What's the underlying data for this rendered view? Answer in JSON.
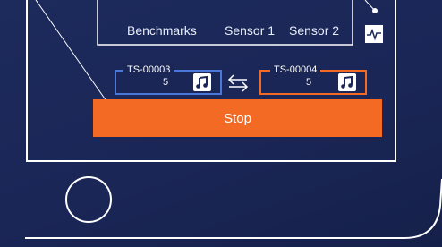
{
  "tabs": [
    "Benchmarks",
    "Sensor 1",
    "Sensor 2"
  ],
  "sources": [
    {
      "id": "TS-00003",
      "count": "5",
      "color": "#4a78d8"
    },
    {
      "id": "TS-00004",
      "count": "5",
      "color": "#f26a24"
    }
  ],
  "stop_label": "Stop",
  "icons": [
    "chart-icon",
    "music-note-icon",
    "swap-arrows-icon"
  ],
  "colors": {
    "accent": "#f26a24",
    "secondary": "#4a78d8",
    "background": "#1c2a5c"
  }
}
